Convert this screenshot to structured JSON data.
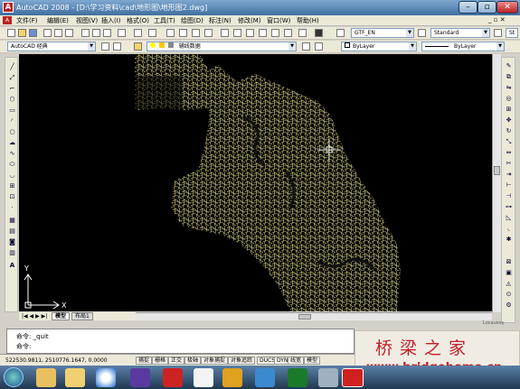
{
  "window": {
    "title": "AutoCAD 2008 - [D:\\学习资料\\cad\\地形图\\地形图2.dwg]"
  },
  "menu": [
    "文件(F)",
    "编辑(E)",
    "视图(V)",
    "插入(I)",
    "格式(O)",
    "工具(T)",
    "绘图(D)",
    "标注(N)",
    "修改(M)",
    "窗口(W)",
    "帮助(H)"
  ],
  "toolbar": {
    "text_style": "GTF_EN",
    "dim_style": "Standard",
    "dim_style_2": "St",
    "workspace": "AutoCAD 经典",
    "layer": "辅线数据",
    "color": "ByLayer",
    "linetype": "ByLayer"
  },
  "canvas": {
    "ucs_y": "Y",
    "ucs_x": "X"
  },
  "layout_tabs": [
    "模型",
    "布局1"
  ],
  "command": {
    "line1": "命令: _quit",
    "line2": "命令:"
  },
  "status": {
    "coords": "522530.9811, 2510776.1647, 0.0000",
    "buttons": [
      "捕捉",
      "栅格",
      "正交",
      "极轴",
      "对象捕捉",
      "对象追踪",
      "DUCS",
      "DYN",
      "线宽",
      "模型"
    ]
  },
  "watermark": {
    "cn": "桥梁之家",
    "url": "www.bridgehome.cn",
    "corner": "Locauxxy"
  },
  "colors": {
    "canvas_bg": "#000000",
    "terrain_lines": "#c8c070",
    "watermark_red": "#c0202a"
  }
}
